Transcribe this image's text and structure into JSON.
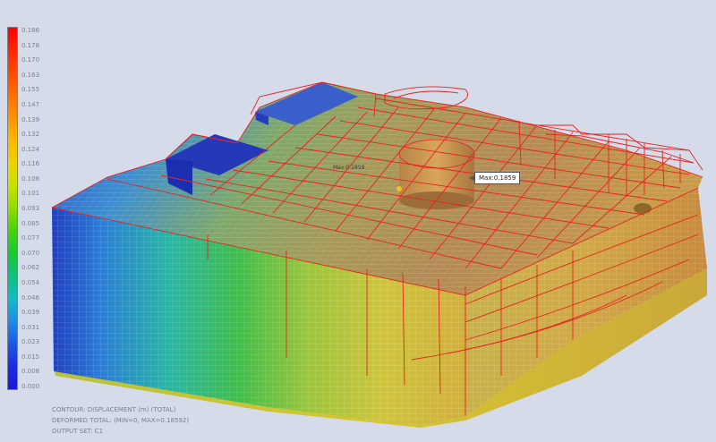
{
  "legend": {
    "label": "color-scale-legend",
    "values": [
      "0.186",
      "0.178",
      "0.170",
      "0.163",
      "0.155",
      "0.147",
      "0.139",
      "0.132",
      "0.124",
      "0.116",
      "0.108",
      "0.101",
      "0.093",
      "0.085",
      "0.077",
      "0.070",
      "0.062",
      "0.054",
      "0.046",
      "0.039",
      "0.031",
      "0.023",
      "0.015",
      "0.008",
      "0.000"
    ],
    "colors": [
      "#ff0000",
      "#ff2400",
      "#ff4a00",
      "#ff6f00",
      "#ff9400",
      "#ffb800",
      "#e9d400",
      "#c9e000",
      "#8fdc00",
      "#46d20a",
      "#18c832",
      "#10c080",
      "#14bcc6",
      "#1c8ce6",
      "#1e56e4",
      "#1a2ee0",
      "#1818d8"
    ]
  },
  "max_callout": "Max:0.1859",
  "node_label": "Max:0.1859",
  "info": {
    "line1": "CONTOUR: DISPLACEMENT (m) (TOTAL)",
    "line2": "DEFORMED TOTAL: (MIN=0, MAX=0.18592)",
    "line3": "OUTPUT SET: C1"
  },
  "colors": {
    "background": "#d6dbea",
    "wire": "#e8231f",
    "mesh": "#ffffff",
    "hull_blue": "#2a4fc9",
    "hull_green": "#4fbf3a",
    "hull_yellow": "#d8c52a",
    "hull_orange": "#c8823a"
  }
}
